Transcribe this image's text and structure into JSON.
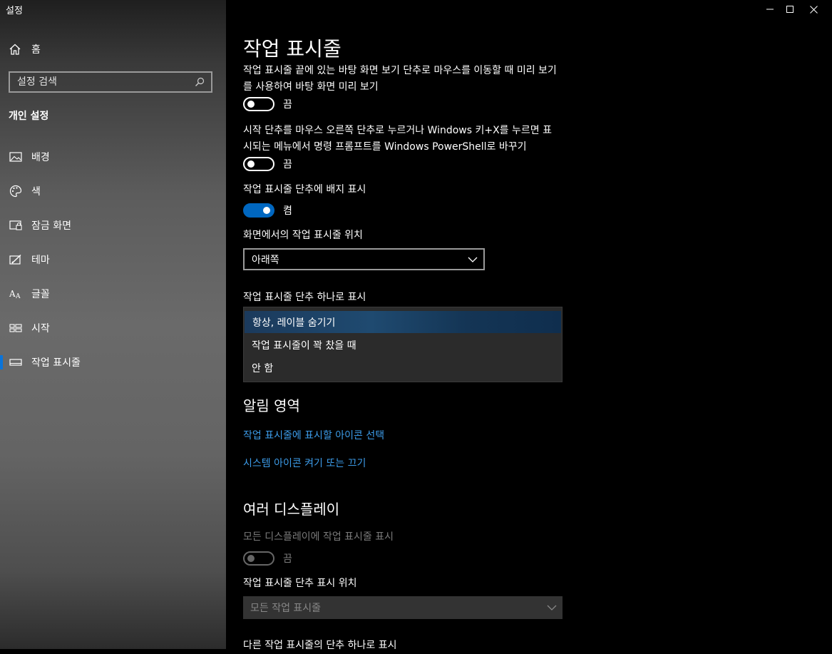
{
  "window": {
    "title": "설정"
  },
  "sidebar": {
    "home_label": "홈",
    "search_placeholder": "설정 검색",
    "section_title": "개인 설정",
    "items": [
      {
        "label": "배경",
        "icon": "picture-icon"
      },
      {
        "label": "색",
        "icon": "palette-icon"
      },
      {
        "label": "잠금 화면",
        "icon": "lock-screen-icon"
      },
      {
        "label": "테마",
        "icon": "theme-icon"
      },
      {
        "label": "글꼴",
        "icon": "font-icon"
      },
      {
        "label": "시작",
        "icon": "start-icon"
      },
      {
        "label": "작업 표시줄",
        "icon": "taskbar-icon",
        "selected": true
      }
    ]
  },
  "main": {
    "title": "작업 표시줄",
    "peek": {
      "label": "작업 표시줄 끝에 있는 바탕 화면 보기 단추로 마우스를 이동할 때 미리 보기를 사용하여 바탕 화면 미리 보기",
      "state": "끔"
    },
    "powershell": {
      "label": "시작 단추를 마우스 오른쪽 단추로 누르거나 Windows 키+X를 누르면 표시되는 메뉴에서 명령 프롬프트를 Windows PowerShell로 바꾸기",
      "state": "끔"
    },
    "badges": {
      "label": "작업 표시줄 단추에 배지 표시",
      "state": "켬"
    },
    "location": {
      "label": "화면에서의 작업 표시줄 위치",
      "value": "아래쪽"
    },
    "combine": {
      "label": "작업 표시줄 단추 하나로 표시",
      "options": [
        "항상, 레이블 숨기기",
        "작업 표시줄이 꽉 찼을 때",
        "안 함"
      ],
      "selected": "항상, 레이블 숨기기"
    },
    "notification": {
      "title": "알림 영역",
      "link1": "작업 표시줄에 표시할 아이콘 선택",
      "link2": "시스템 아이콘 켜기 또는 끄기"
    },
    "multi": {
      "title": "여러 디스플레이",
      "show_all": {
        "label": "모든 디스플레이에 작업 표시줄 표시",
        "state": "끔"
      },
      "buttons_on": {
        "label": "작업 표시줄 단추 표시 위치",
        "value": "모든 작업 표시줄"
      },
      "combine_other": {
        "label": "다른 작업 표시줄의 단추 하나로 표시"
      }
    }
  },
  "colors": {
    "accent": "#0067c0",
    "link": "#3c9be8"
  }
}
